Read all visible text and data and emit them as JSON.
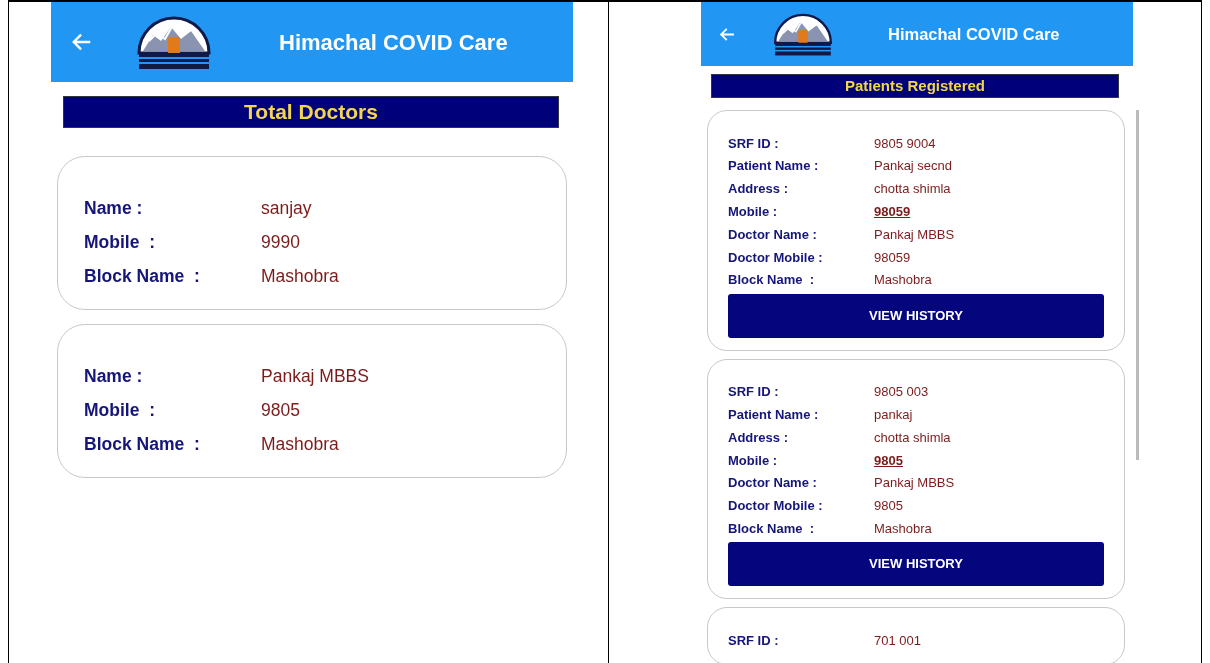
{
  "screens": [
    {
      "app_title": "Himachal COVID Care",
      "section_title": "Total Doctors",
      "cards": [
        {
          "fields": [
            {
              "label": "Name :",
              "value": "sanjay",
              "kind": "text"
            },
            {
              "label": "Mobile  :",
              "value": "9990",
              "kind": "text"
            },
            {
              "label": "Block Name  :",
              "value": "Mashobra",
              "kind": "text"
            }
          ]
        },
        {
          "fields": [
            {
              "label": "Name :",
              "value": "Pankaj MBBS",
              "kind": "text"
            },
            {
              "label": "Mobile  :",
              "value": "9805",
              "kind": "text"
            },
            {
              "label": "Block Name  :",
              "value": "Mashobra",
              "kind": "text"
            }
          ]
        }
      ]
    },
    {
      "app_title": "Himachal COVID Care",
      "section_title": "Patients Registered",
      "cards": [
        {
          "fields": [
            {
              "label": "SRF ID :",
              "value": "9805 9004",
              "kind": "text"
            },
            {
              "label": "Patient Name :",
              "value": "Pankaj secnd",
              "kind": "text"
            },
            {
              "label": "Address :",
              "value": "chotta shimla",
              "kind": "text"
            },
            {
              "label": "Mobile :",
              "value": "98059",
              "kind": "link"
            },
            {
              "label": "Doctor Name :",
              "value": "Pankaj MBBS",
              "kind": "text"
            },
            {
              "label": "Doctor Mobile :",
              "value": "98059",
              "kind": "text"
            },
            {
              "label": "Block Name  :",
              "value": "Mashobra",
              "kind": "text"
            }
          ],
          "button": "VIEW HISTORY"
        },
        {
          "fields": [
            {
              "label": "SRF ID :",
              "value": "9805 003",
              "kind": "text"
            },
            {
              "label": "Patient Name :",
              "value": "pankaj",
              "kind": "text"
            },
            {
              "label": "Address :",
              "value": "chotta shimla",
              "kind": "text"
            },
            {
              "label": "Mobile :",
              "value": "9805",
              "kind": "link"
            },
            {
              "label": "Doctor Name :",
              "value": "Pankaj MBBS",
              "kind": "text"
            },
            {
              "label": "Doctor Mobile :",
              "value": "9805",
              "kind": "text"
            },
            {
              "label": "Block Name  :",
              "value": "Mashobra",
              "kind": "text"
            }
          ],
          "button": "VIEW HISTORY"
        },
        {
          "fields": [
            {
              "label": "SRF ID :",
              "value": "701 001",
              "kind": "text"
            }
          ]
        }
      ]
    }
  ]
}
